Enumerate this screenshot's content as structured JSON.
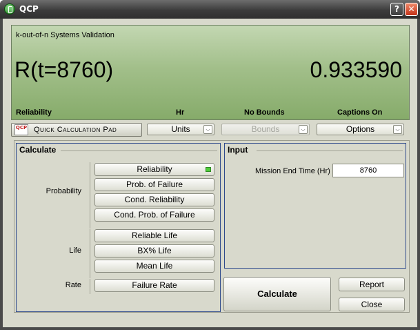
{
  "window": {
    "title": "QCP",
    "help_glyph": "?",
    "close_glyph": "✕"
  },
  "display": {
    "header": "k-out-of-n Systems Validation",
    "expression": "R(t=8760)",
    "result": "0.933590",
    "captions": [
      "Reliability",
      "Hr",
      "No Bounds",
      "Captions On"
    ]
  },
  "toolbar": {
    "qcp_logo": "QCP",
    "qcp_label": "Quick Calculation Pad",
    "units": "Units",
    "bounds": "Bounds",
    "options": "Options",
    "chevron": "⌵"
  },
  "calculate": {
    "title": "Calculate",
    "groups": {
      "probability": "Probability",
      "life": "Life",
      "rate": "Rate"
    },
    "buttons": [
      "Reliability",
      "Prob. of Failure",
      "Cond. Reliability",
      "Cond. Prob. of Failure",
      "Reliable Life",
      "BX% Life",
      "Mean Life",
      "Failure Rate"
    ]
  },
  "input": {
    "title": "Input",
    "mission_label": "Mission End Time (Hr)",
    "mission_value": "8760"
  },
  "actions": {
    "calculate": "Calculate",
    "report": "Report",
    "close": "Close"
  },
  "colors": {
    "display_green": "#a2bf8a",
    "panel_border": "#2e4a8c",
    "active_led": "#4fcc3a"
  }
}
